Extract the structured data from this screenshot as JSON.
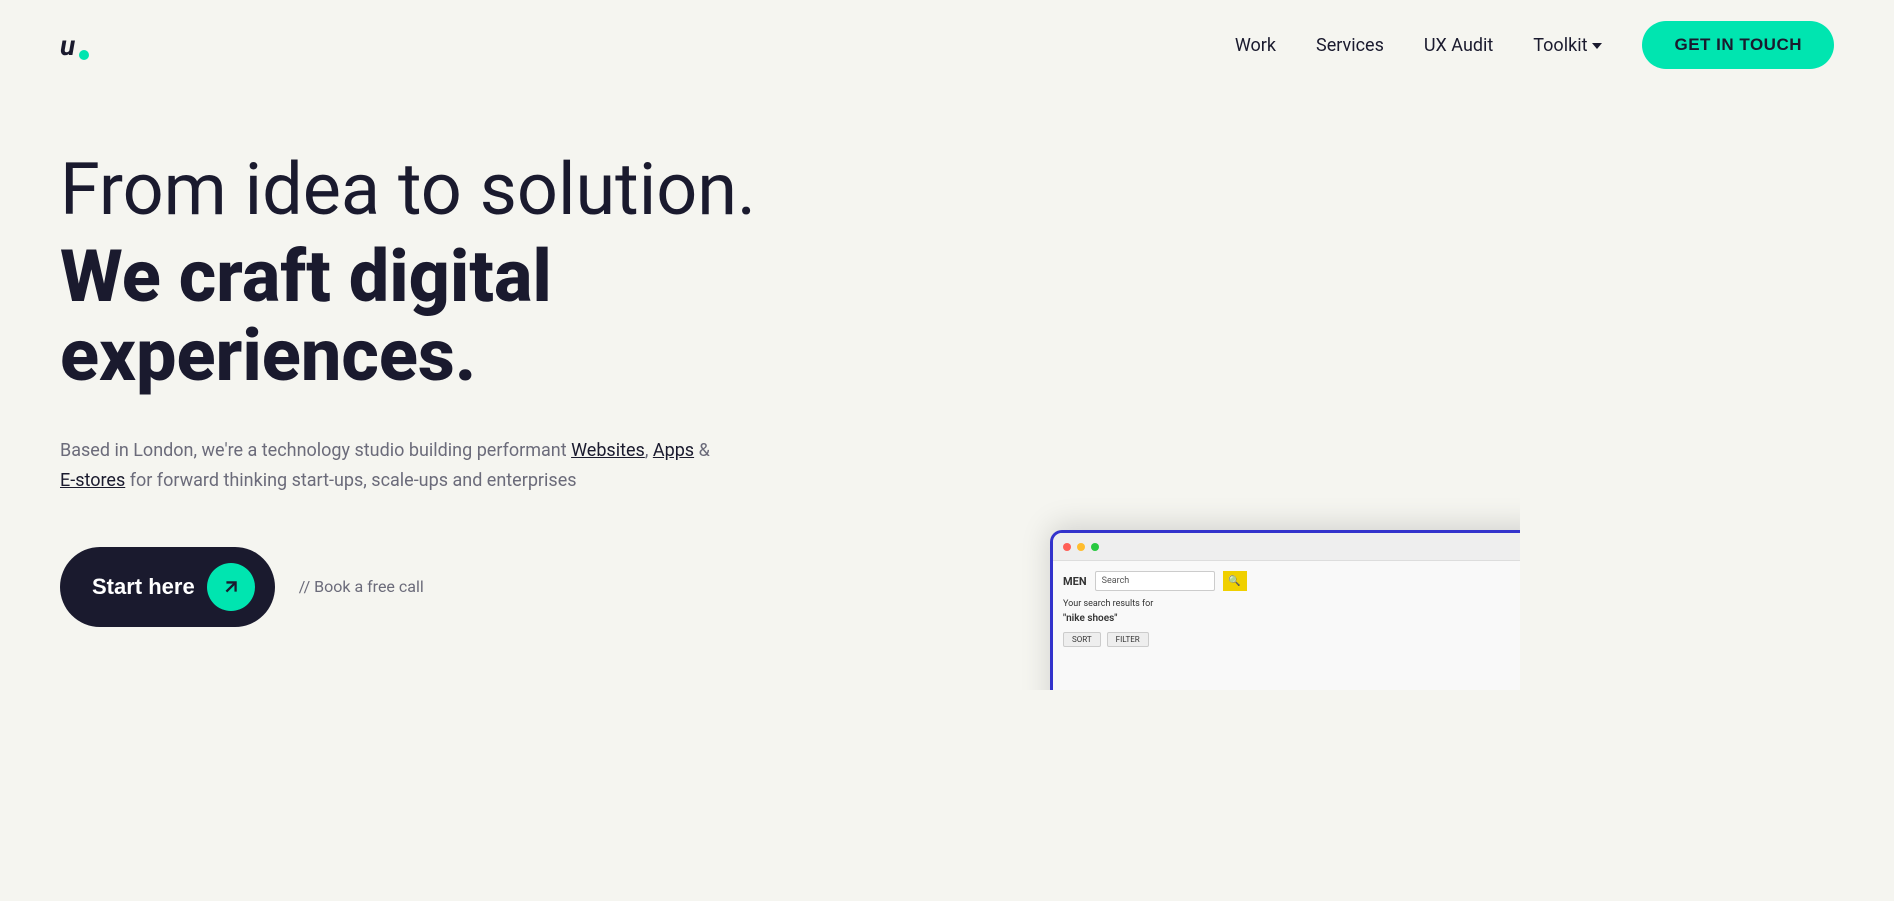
{
  "brand": {
    "logo_letter": "u",
    "logo_dot_color": "#00e5b0"
  },
  "nav": {
    "work_label": "Work",
    "services_label": "Services",
    "ux_audit_label": "UX Audit",
    "toolkit_label": "Toolkit",
    "cta_label": "GET IN TOUCH"
  },
  "hero": {
    "line1": "From idea to solution.",
    "line2": "We craft digital experiences.",
    "description_part1": "Based in London, we're a technology studio building performant",
    "link_websites": "Websites",
    "link_apps": "Apps",
    "description_amp": "&",
    "link_estores": "E-stores",
    "description_part2": "for forward thinking start-ups, scale-ups and enterprises",
    "start_btn_label": "Start here",
    "book_call_label": "// Book a free call"
  },
  "preview": {
    "men_label": "MEN",
    "search_placeholder": "Search",
    "results_text": "Your search results for",
    "results_query": "\"nike shoes\"",
    "sort_label": "SORT",
    "filter_label": "FILTER"
  },
  "colors": {
    "accent": "#00e5b0",
    "dark": "#1a1a2e",
    "bg": "#f5f5f0",
    "text_muted": "#6b6b7a",
    "border_blue": "#3333cc"
  }
}
